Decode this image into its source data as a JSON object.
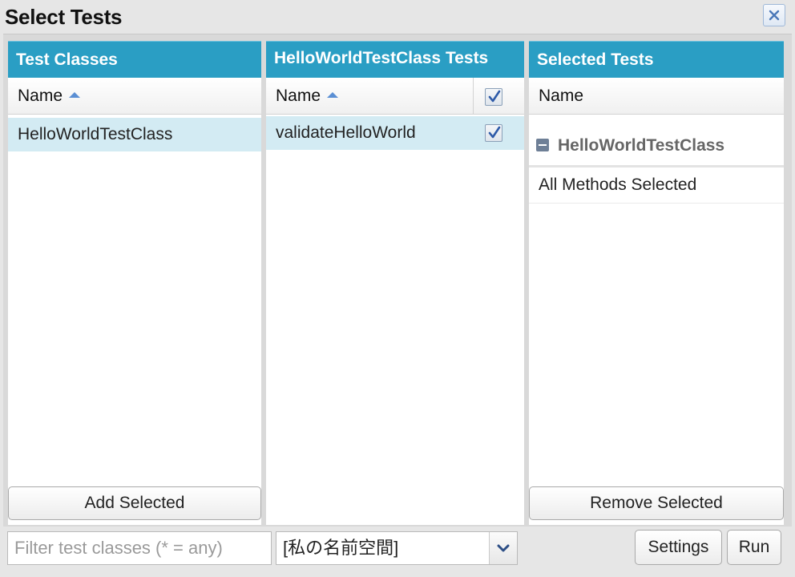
{
  "dialog": {
    "title": "Select Tests"
  },
  "test_classes": {
    "header": "Test Classes",
    "column": "Name",
    "rows": [
      "HelloWorldTestClass"
    ],
    "add_button": "Add Selected"
  },
  "class_tests": {
    "header": "HelloWorldTestClass Tests",
    "column": "Name",
    "rows": [
      {
        "label": "validateHelloWorld",
        "checked": true
      }
    ],
    "header_checkbox_checked": true
  },
  "selected_tests": {
    "header": "Selected Tests",
    "column": "Name",
    "group_label": "HelloWorldTestClass",
    "group_detail": "All Methods Selected",
    "remove_button": "Remove Selected"
  },
  "footer": {
    "filter_placeholder": "Filter test classes (* = any)",
    "namespace_value": "[私の名前空間]",
    "settings_button": "Settings",
    "run_button": "Run"
  },
  "colors": {
    "panel_header": "#2a9ec4",
    "selected_row": "#d3ebf3"
  },
  "icons": [
    "close-icon",
    "sort-ascending-icon",
    "checkbox-icon",
    "collapse-icon",
    "chevron-down-icon"
  ]
}
